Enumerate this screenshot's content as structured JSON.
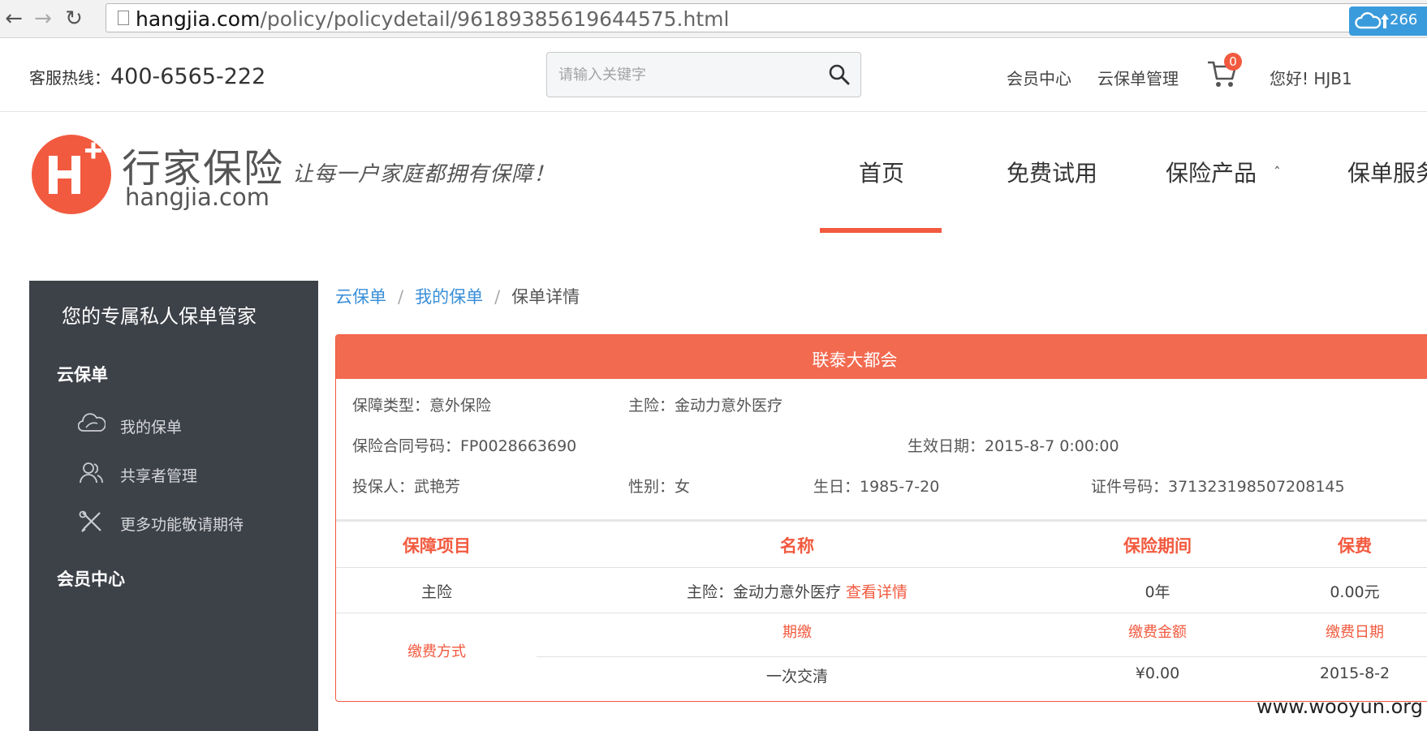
{
  "browser": {
    "url_host": "hangjia.com",
    "url_path": "/policy/policydetail/96189385619644575.html"
  },
  "topbar": {
    "hotline_label": "客服热线：",
    "hotline_number": "400-6565-222",
    "search_placeholder": "请输入关键字",
    "member_center": "会员中心",
    "cloud_policy_mgmt": "云保单管理",
    "cart_count": "0",
    "greeting": "您好! HJB1",
    "upload_count": "266"
  },
  "header": {
    "brand_cn": "行家保险",
    "brand_en": "hangjia.com",
    "slogan": "让每一户家庭都拥有保障！",
    "nav": [
      "首页",
      "免费试用",
      "保险产品",
      "保单服务"
    ],
    "active_nav_index": 0
  },
  "sidebar": {
    "title": "您的专属私人保单管家",
    "group1": "云保单",
    "items": [
      {
        "label": "我的保单",
        "icon": "cloud-icon"
      },
      {
        "label": "共享者管理",
        "icon": "users-icon"
      },
      {
        "label": "更多功能敬请期待",
        "icon": "tools-icon"
      }
    ],
    "group2": "会员中心"
  },
  "breadcrumb": [
    "云保单",
    "我的保单",
    "保单详情"
  ],
  "policy": {
    "company": "联泰大都会",
    "type": "保障类型：意外保险",
    "main_insurance": "主险：金动力意外医疗",
    "contract_no": "保险合同号码：FP0028663690",
    "effective_date": "生效日期：2015-8-7 0:00:00",
    "holder": "投保人：武艳芳",
    "gender": "性别：女",
    "birthday": "生日：1985-7-20",
    "id_no": "证件号码：371323198507208145"
  },
  "table": {
    "headers": [
      "保障项目",
      "名称",
      "保险期间",
      "保费"
    ],
    "row": {
      "item": "主险",
      "name": "主险：金动力意外医疗",
      "detail_link": "查看详情",
      "period": "0年",
      "premium": "0.00元"
    },
    "payment": {
      "label": "缴费方式",
      "sub_headers": [
        "期缴",
        "缴费金额",
        "缴费日期"
      ],
      "values": [
        "一次交清",
        "¥0.00",
        "2015-8-2"
      ]
    }
  },
  "watermark": "www.wooyun.org",
  "colors": {
    "accent": "#f25a3f",
    "sidebar_bg": "#3d4148",
    "link_blue": "#3a8fd8"
  }
}
